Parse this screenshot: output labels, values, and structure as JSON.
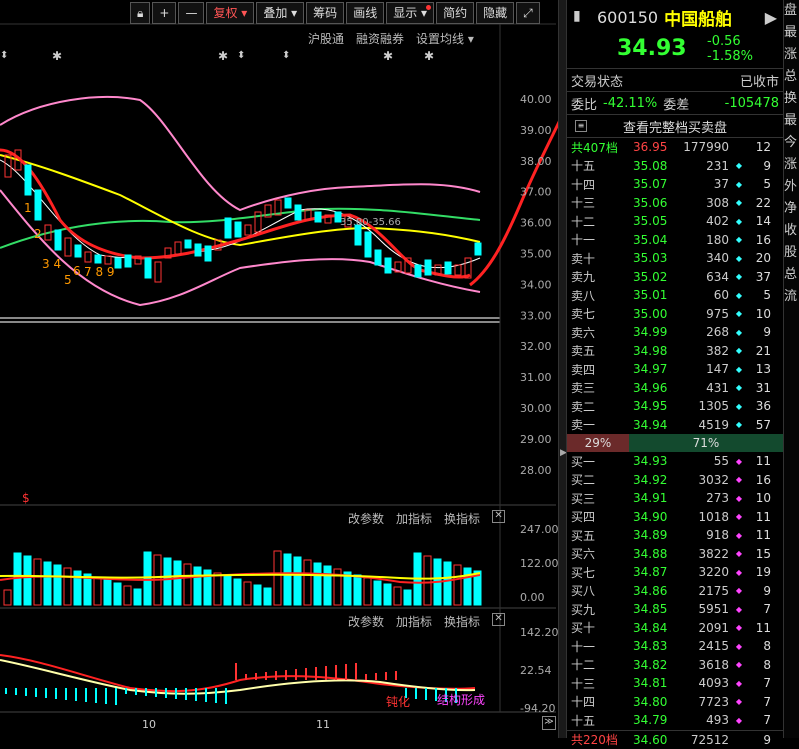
{
  "toolbar": {
    "lock_icon": "lock-icon",
    "plus": "+",
    "minus": "—",
    "fq": "复权",
    "add": "叠加",
    "chip": "筹码",
    "draw": "画线",
    "show": "显示",
    "simple": "简约",
    "hide": "隐藏",
    "expand": "⤢"
  },
  "subbar": {
    "hgt": "沪股通",
    "rzrq": "融资融券",
    "setma": "设置均线"
  },
  "ind1": {
    "params": "改参数",
    "add": "加指标",
    "swap": "换指标",
    "close": "✕"
  },
  "ind2": {
    "params": "改参数",
    "add": "加指标",
    "swap": "换指标",
    "close": "✕"
  },
  "axis": {
    "main": [
      "40.00",
      "39.00",
      "38.00",
      "37.00",
      "36.00",
      "35.00",
      "34.00",
      "33.00",
      "32.00",
      "31.00",
      "30.00",
      "29.00",
      "28.00"
    ],
    "vol": [
      "247.00",
      "122.00",
      "0.00"
    ],
    "ind": [
      "142.20",
      "22.54",
      "-94.20"
    ],
    "date1": "10",
    "date2": "11"
  },
  "chart_text": {
    "range": "35.80-35.66",
    "label1": "1",
    "label2": "2",
    "label34": "3 4",
    "label6": "6",
    "label5": "5",
    "label789": "7 8 9",
    "dollar": "$",
    "dun": "钝化",
    "jg": "结构形成"
  },
  "colors": {
    "up": "#ff3333",
    "down": "#00ffff",
    "ma_yellow": "#ffff00",
    "ma_green": "#33dd66",
    "boll": "#ff88cc",
    "accent": "#ffff00"
  },
  "quote": {
    "code": "600150",
    "name": "中国船舶",
    "price": "34.93",
    "change": "-0.56",
    "pct": "-1.58%",
    "nav_icon": "arrow-right-icon"
  },
  "info": {
    "status_label": "交易状态",
    "status_value": "已收市",
    "wb_label": "委比",
    "wb_value": "-42.11%",
    "wc_label": "委差",
    "wc_value": "-105478",
    "full_book": "查看完整档买卖盘"
  },
  "sell_total": {
    "label": "共407档",
    "price": "36.95",
    "vol": "177990",
    "cnt": "12"
  },
  "asks": [
    {
      "lv": "十五",
      "px": "35.08",
      "vol": "231",
      "cnt": "9"
    },
    {
      "lv": "十四",
      "px": "35.07",
      "vol": "37",
      "cnt": "5"
    },
    {
      "lv": "十三",
      "px": "35.06",
      "vol": "308",
      "cnt": "22"
    },
    {
      "lv": "十二",
      "px": "35.05",
      "vol": "402",
      "cnt": "14"
    },
    {
      "lv": "十一",
      "px": "35.04",
      "vol": "180",
      "cnt": "16"
    },
    {
      "lv": "卖十",
      "px": "35.03",
      "vol": "340",
      "cnt": "20"
    },
    {
      "lv": "卖九",
      "px": "35.02",
      "vol": "634",
      "cnt": "37"
    },
    {
      "lv": "卖八",
      "px": "35.01",
      "vol": "60",
      "cnt": "5"
    },
    {
      "lv": "卖七",
      "px": "35.00",
      "vol": "975",
      "cnt": "10"
    },
    {
      "lv": "卖六",
      "px": "34.99",
      "vol": "268",
      "cnt": "9"
    },
    {
      "lv": "卖五",
      "px": "34.98",
      "vol": "382",
      "cnt": "21"
    },
    {
      "lv": "卖四",
      "px": "34.97",
      "vol": "147",
      "cnt": "13"
    },
    {
      "lv": "卖三",
      "px": "34.96",
      "vol": "431",
      "cnt": "31"
    },
    {
      "lv": "卖二",
      "px": "34.95",
      "vol": "1305",
      "cnt": "36"
    },
    {
      "lv": "卖一",
      "px": "34.94",
      "vol": "4519",
      "cnt": "57"
    }
  ],
  "ratio": {
    "buy": "29%",
    "sell": "71%"
  },
  "bids": [
    {
      "lv": "买一",
      "px": "34.93",
      "vol": "55",
      "cnt": "11"
    },
    {
      "lv": "买二",
      "px": "34.92",
      "vol": "3032",
      "cnt": "16"
    },
    {
      "lv": "买三",
      "px": "34.91",
      "vol": "273",
      "cnt": "10"
    },
    {
      "lv": "买四",
      "px": "34.90",
      "vol": "1018",
      "cnt": "11"
    },
    {
      "lv": "买五",
      "px": "34.89",
      "vol": "918",
      "cnt": "11"
    },
    {
      "lv": "买六",
      "px": "34.88",
      "vol": "3822",
      "cnt": "15"
    },
    {
      "lv": "买七",
      "px": "34.87",
      "vol": "3220",
      "cnt": "19"
    },
    {
      "lv": "买八",
      "px": "34.86",
      "vol": "2175",
      "cnt": "9"
    },
    {
      "lv": "买九",
      "px": "34.85",
      "vol": "5951",
      "cnt": "7"
    },
    {
      "lv": "买十",
      "px": "34.84",
      "vol": "2091",
      "cnt": "11"
    },
    {
      "lv": "十一",
      "px": "34.83",
      "vol": "2415",
      "cnt": "8"
    },
    {
      "lv": "十二",
      "px": "34.82",
      "vol": "3618",
      "cnt": "8"
    },
    {
      "lv": "十三",
      "px": "34.81",
      "vol": "4093",
      "cnt": "7"
    },
    {
      "lv": "十四",
      "px": "34.80",
      "vol": "7723",
      "cnt": "7"
    },
    {
      "lv": "十五",
      "px": "34.79",
      "vol": "493",
      "cnt": "7"
    }
  ],
  "buy_total": {
    "label": "共220档",
    "price": "34.60",
    "vol": "72512",
    "cnt": "9"
  },
  "right_tabs": [
    "盘",
    "最",
    "涨",
    "总",
    "换",
    "最",
    "今",
    "涨",
    "外",
    "净",
    "收",
    "股",
    "总",
    "流"
  ]
}
